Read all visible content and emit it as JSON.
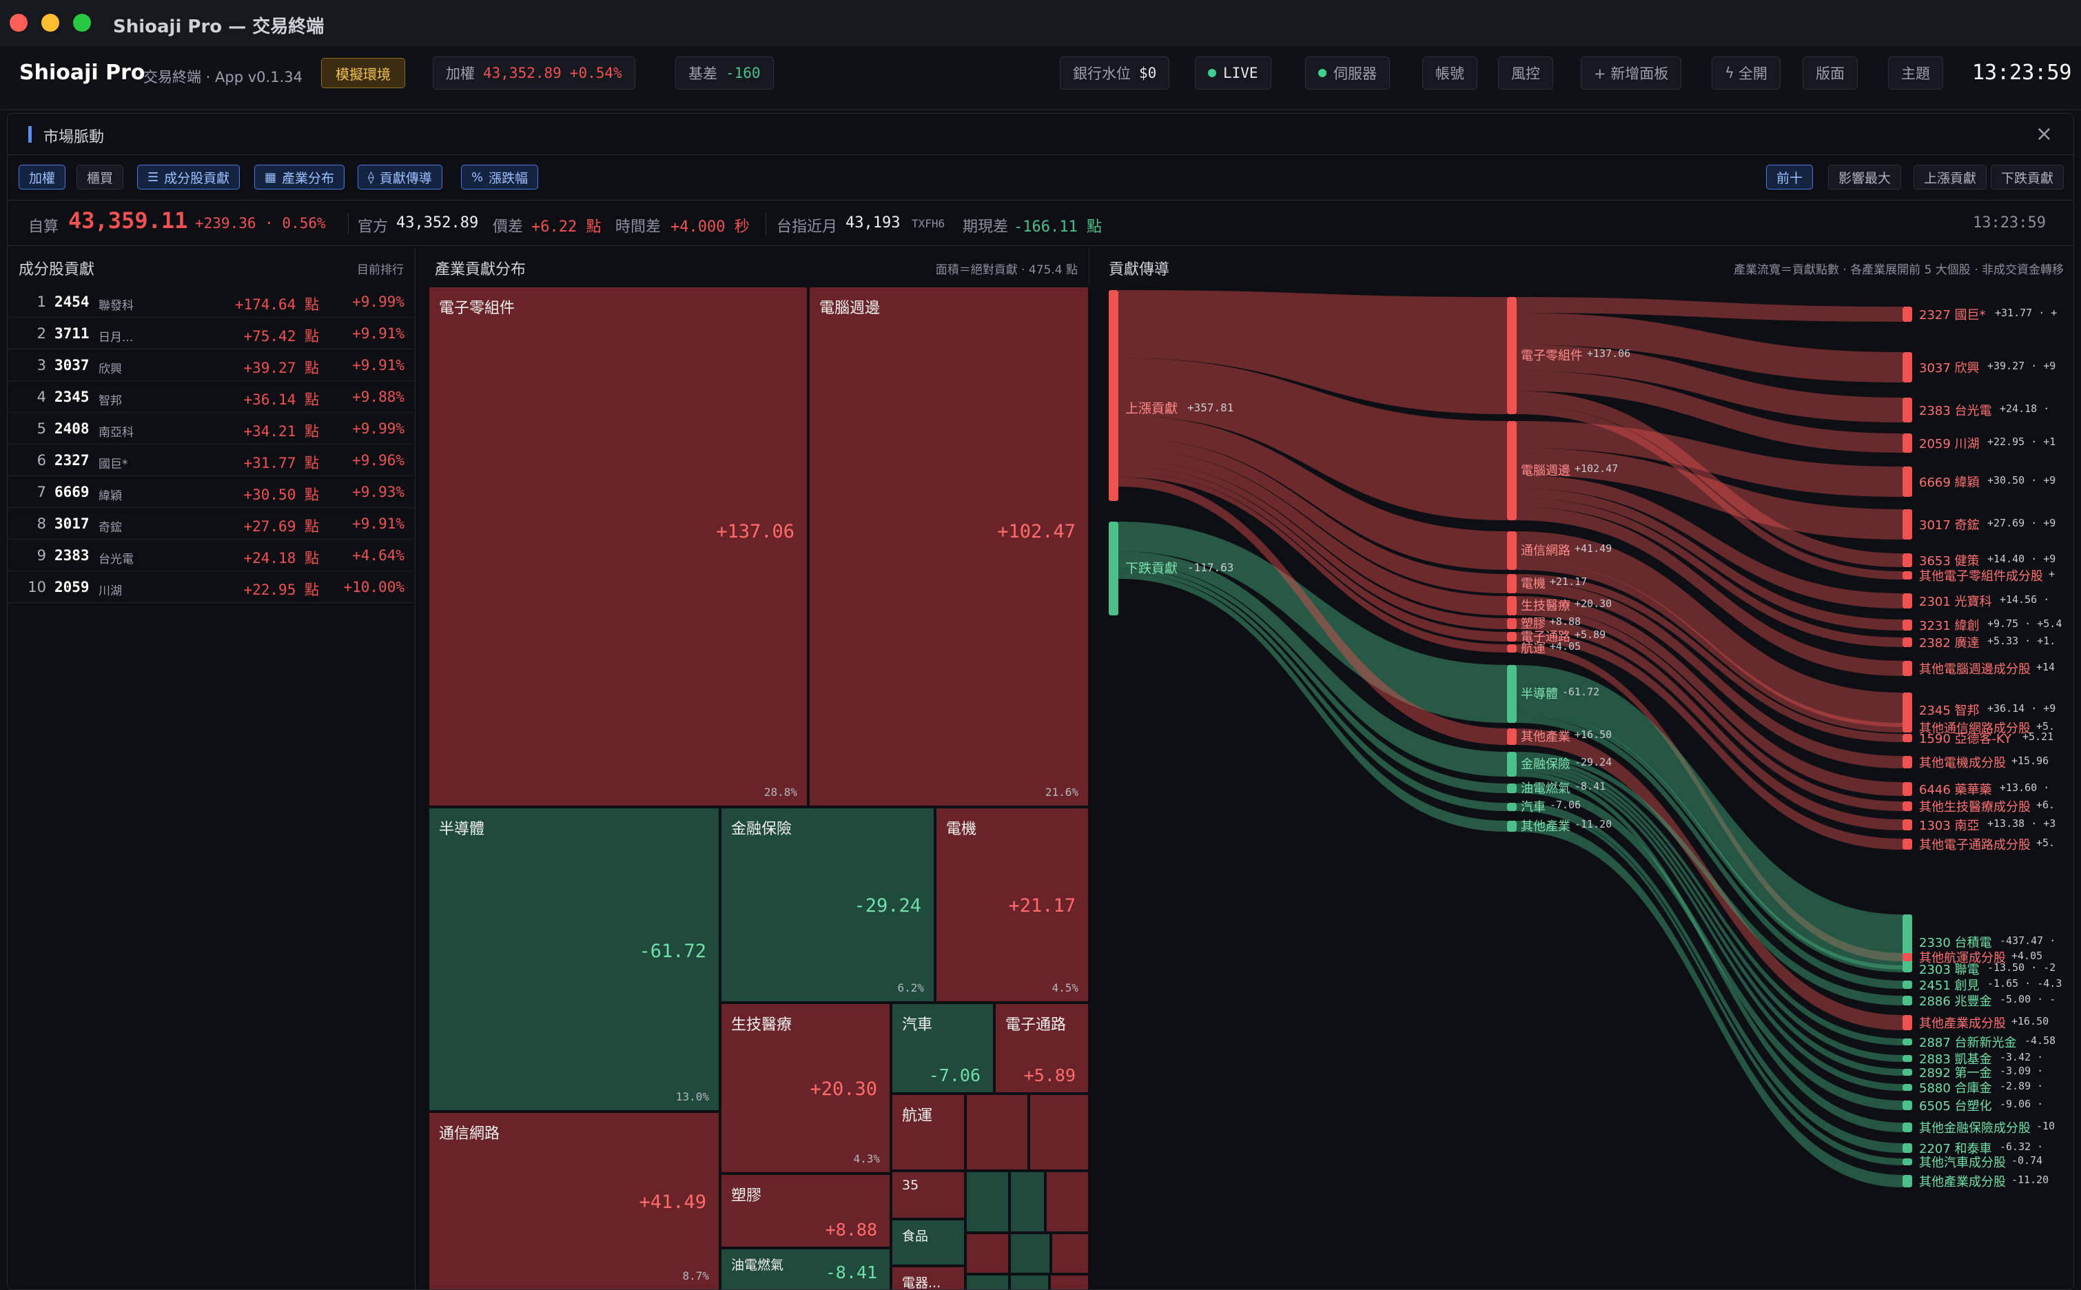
{
  "window": {
    "title": "Shioaji Pro — 交易終端"
  },
  "header": {
    "app_name": "Shioaji Pro",
    "app_sub": "交易終端 · App v0.1.34",
    "env_badge": "模擬環境",
    "index_label": "加權",
    "index_value": "43,352.89",
    "index_change": "+0.54%",
    "basis_label": "基差",
    "basis_value": "-160",
    "bank_label": "銀行水位",
    "bank_value": "$0",
    "live": "LIVE",
    "server": "伺服器",
    "account": "帳號",
    "risk": "風控",
    "add_panel": "+ 新增面板",
    "all_open": "全開",
    "layout": "版面",
    "theme": "主題",
    "clock": "13:23:59"
  },
  "panel": {
    "title": "市場脈動",
    "close": "×",
    "mode_tabs": [
      "加權",
      "櫃買"
    ],
    "view_tabs": [
      {
        "label": "成分股貢獻",
        "icon": "☰"
      },
      {
        "label": "產業分布",
        "icon": "▦"
      },
      {
        "label": "貢獻傳導",
        "icon": "⟠"
      },
      {
        "label": "漲跌幅",
        "icon": "%"
      }
    ],
    "rank_tabs": [
      "前十",
      "影響最大",
      "上漲貢獻",
      "下跌貢獻"
    ]
  },
  "stats": {
    "self_label": "自算",
    "self_value": "43,359.11",
    "self_change": "+239.36 · 0.56%",
    "official_label": "官方",
    "official_value": "43,352.89",
    "price_diff_label": "價差",
    "price_diff_value": "+6.22 點",
    "time_diff_label": "時間差",
    "time_diff_value": "+4.000 秒",
    "future_label": "台指近月",
    "future_value": "43,193",
    "future_code": "TXFH6",
    "spread_label": "期現差",
    "spread_value": "-166.11 點",
    "time": "13:23:59"
  },
  "constituents": {
    "title": "成分股貢獻",
    "meta": "目前排行",
    "rows": [
      {
        "rank": "1",
        "code": "2454",
        "name": "聯發科",
        "points": "+174.64 點",
        "pct": "+9.99%"
      },
      {
        "rank": "2",
        "code": "3711",
        "name": "日月...",
        "points": "+75.42 點",
        "pct": "+9.91%"
      },
      {
        "rank": "3",
        "code": "3037",
        "name": "欣興",
        "points": "+39.27 點",
        "pct": "+9.91%"
      },
      {
        "rank": "4",
        "code": "2345",
        "name": "智邦",
        "points": "+36.14 點",
        "pct": "+9.88%"
      },
      {
        "rank": "5",
        "code": "2408",
        "name": "南亞科",
        "points": "+34.21 點",
        "pct": "+9.99%"
      },
      {
        "rank": "6",
        "code": "2327",
        "name": "國巨*",
        "points": "+31.77 點",
        "pct": "+9.96%"
      },
      {
        "rank": "7",
        "code": "6669",
        "name": "緯穎",
        "points": "+30.50 點",
        "pct": "+9.93%"
      },
      {
        "rank": "8",
        "code": "3017",
        "name": "奇鋐",
        "points": "+27.69 點",
        "pct": "+9.91%"
      },
      {
        "rank": "9",
        "code": "2383",
        "name": "台光電",
        "points": "+24.18 點",
        "pct": "+4.64%"
      },
      {
        "rank": "10",
        "code": "2059",
        "name": "川湖",
        "points": "+22.95 點",
        "pct": "+10.00%"
      }
    ]
  },
  "industry": {
    "title": "產業貢獻分布",
    "meta": "面積＝絕對貢獻 · 475.4 點",
    "tiles": [
      {
        "name": "電子零組件",
        "value": "+137.06",
        "pct": "28.8%",
        "sign": "r"
      },
      {
        "name": "電腦週邊",
        "value": "+102.47",
        "pct": "21.6%",
        "sign": "r"
      },
      {
        "name": "半導體",
        "value": "-61.72",
        "pct": "13.0%",
        "sign": "g"
      },
      {
        "name": "金融保險",
        "value": "-29.24",
        "pct": "6.2%",
        "sign": "g"
      },
      {
        "name": "電機",
        "value": "+21.17",
        "pct": "4.5%",
        "sign": "r"
      },
      {
        "name": "通信網路",
        "value": "+41.49",
        "pct": "8.7%",
        "sign": "r"
      },
      {
        "name": "生技醫療",
        "value": "+20.30",
        "pct": "4.3%",
        "sign": "r"
      },
      {
        "name": "汽車",
        "value": "-7.06",
        "pct": "",
        "sign": "g"
      },
      {
        "name": "電子通路",
        "value": "+5.89",
        "pct": "",
        "sign": "r"
      },
      {
        "name": "航運",
        "value": "",
        "pct": "",
        "sign": "r"
      },
      {
        "name": "塑膠",
        "value": "+8.88",
        "pct": "",
        "sign": "r"
      },
      {
        "name": "35",
        "value": "",
        "pct": "",
        "sign": "r"
      },
      {
        "name": "食品",
        "value": "",
        "pct": "",
        "sign": "g"
      },
      {
        "name": "油電燃氣",
        "value": "-8.41",
        "pct": "",
        "sign": "g"
      },
      {
        "name": "電器...",
        "value": "",
        "pct": "",
        "sign": "r"
      }
    ]
  },
  "flow": {
    "title": "貢獻傳導",
    "meta": "產業流寬＝貢獻點數 · 各產業展開前 5 大個股 · 非成交資金轉移",
    "roots": [
      {
        "name": "上漲貢獻",
        "value": "+357.81"
      },
      {
        "name": "下跌貢獻",
        "value": "-117.63"
      }
    ],
    "industries": [
      {
        "name": "電子零組件",
        "value": "+137.06"
      },
      {
        "name": "電腦週邊",
        "value": "+102.47"
      },
      {
        "name": "通信網路",
        "value": "+41.49"
      },
      {
        "name": "電機",
        "value": "+21.17"
      },
      {
        "name": "生技醫療",
        "value": "+20.30"
      },
      {
        "name": "塑膠",
        "value": "+8.88"
      },
      {
        "name": "電子通路",
        "value": "+5.89"
      },
      {
        "name": "航運",
        "value": "+4.05"
      },
      {
        "name": "半導體",
        "value": "-61.72"
      },
      {
        "name": "其他產業",
        "value": "+16.50"
      },
      {
        "name": "金融保險",
        "value": "-29.24"
      },
      {
        "name": "油電燃氣",
        "value": "-8.41"
      },
      {
        "name": "汽車",
        "value": "-7.06"
      },
      {
        "name": "其他產業",
        "value": "-11.20"
      }
    ],
    "stocks": [
      {
        "name": "2327 國巨*",
        "value": "+31.77 · +"
      },
      {
        "name": "3037 欣興",
        "value": "+39.27 · +9"
      },
      {
        "name": "2383 台光電",
        "value": "+24.18 ·"
      },
      {
        "name": "2059 川湖",
        "value": "+22.95 · +1"
      },
      {
        "name": "6669 緯穎",
        "value": "+30.50 · +9"
      },
      {
        "name": "3017 奇鋐",
        "value": "+27.69 · +9"
      },
      {
        "name": "3653 健策",
        "value": "+14.40 · +9"
      },
      {
        "name": "其他電子零組件成分股",
        "value": "+"
      },
      {
        "name": "2301 光寶科",
        "value": "+14.56 ·"
      },
      {
        "name": "3231 緯創",
        "value": "+9.75 · +5.4"
      },
      {
        "name": "2382 廣達",
        "value": "+5.33 · +1."
      },
      {
        "name": "其他電腦週邊成分股",
        "value": "+14"
      },
      {
        "name": "2345 智邦",
        "value": "+36.14 · +9"
      },
      {
        "name": "其他通信網路成分股",
        "value": "+5."
      },
      {
        "name": "1590 亞德客-KY",
        "value": "+5.21"
      },
      {
        "name": "其他電機成分股",
        "value": "+15.96"
      },
      {
        "name": "6446 藥華藥",
        "value": "+13.60 ·"
      },
      {
        "name": "其他生技醫療成分股",
        "value": "+6."
      },
      {
        "name": "1303 南亞",
        "value": "+13.38 · +3"
      },
      {
        "name": "其他電子通路成分股",
        "value": "+5."
      },
      {
        "name": "2330 台積電",
        "value": "-437.47 ·"
      },
      {
        "name": "其他航運成分股",
        "value": "+4.05"
      },
      {
        "name": "2303 聯電",
        "value": "-13.50 · -2"
      },
      {
        "name": "2451 創見",
        "value": "-1.65 · -4.3"
      },
      {
        "name": "2886 兆豐金",
        "value": "-5.00 · -"
      },
      {
        "name": "其他產業成分股",
        "value": "+16.50"
      },
      {
        "name": "2887 台新新光金",
        "value": "-4.58"
      },
      {
        "name": "2883 凱基金",
        "value": "-3.42 ·"
      },
      {
        "name": "2892 第一金",
        "value": "-3.09 ·"
      },
      {
        "name": "5880 合庫金",
        "value": "-2.89 ·"
      },
      {
        "name": "6505 台塑化",
        "value": "-9.06 ·"
      },
      {
        "name": "其他金融保險成分股",
        "value": "-10"
      },
      {
        "name": "2207 和泰車",
        "value": "-6.32 ·"
      },
      {
        "name": "其他汽車成分股",
        "value": "-0.74"
      },
      {
        "name": "其他產業成分股",
        "value": "-11.20"
      }
    ]
  },
  "colors": {
    "up": "#f05252",
    "down": "#4cc08a",
    "accent": "#5b8def"
  }
}
